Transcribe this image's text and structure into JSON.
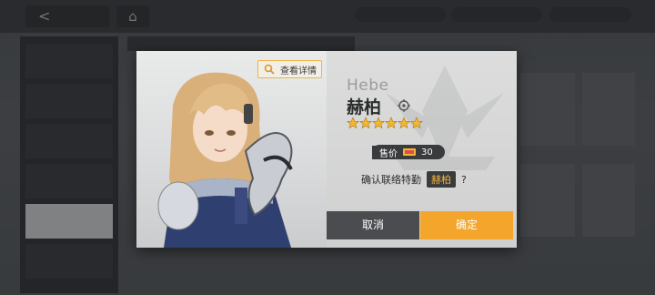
{
  "nav": {
    "back_glyph": "<",
    "home_glyph": "⌂"
  },
  "dialog": {
    "details_label": "查看详情",
    "english_name": "Hebe",
    "chinese_name": "赫柏",
    "star_count": 6,
    "price_label": "售价",
    "price_value": "30",
    "confirm_prefix": "确认联络特勤",
    "confirm_name": "赫柏",
    "confirm_suffix": "?",
    "cancel_label": "取消",
    "ok_label": "确定"
  },
  "colors": {
    "accent": "#f4a52b",
    "star": "#f2b632",
    "dark": "#3a3b3d"
  },
  "icons": [
    "back-arrow-icon",
    "home-icon",
    "magnifier-icon",
    "location-icon",
    "star-icon",
    "ticket-icon",
    "emblem-icon"
  ]
}
